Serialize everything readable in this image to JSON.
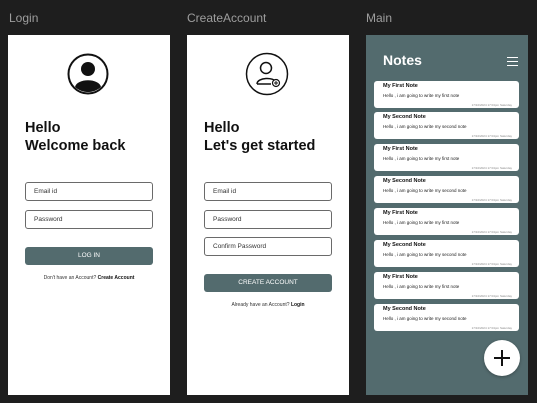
{
  "frames": {
    "login_label": "Login",
    "create_label": "CreateAccount",
    "main_label": "Main"
  },
  "login": {
    "heading_line1": "Hello",
    "heading_line2": "Welcome back",
    "email_placeholder": "Email id",
    "password_placeholder": "Password",
    "login_button": "LOG IN",
    "footer_text": "Don't have an Account? ",
    "footer_link": "Create Account"
  },
  "create": {
    "heading_line1": "Hello",
    "heading_line2": "Let's get started",
    "email_placeholder": "Email id",
    "password_placeholder": "Password",
    "confirm_placeholder": "Confirm Password",
    "create_button": "CREATE ACCOUNT",
    "footer_text": "Already have an Account? ",
    "footer_link": "Login"
  },
  "main": {
    "title": "Notes",
    "notes": [
      {
        "title": "My First Note",
        "body": "Hello , i am going to write my first note",
        "timestamp": "17/10/2024 17:04pm Saturday"
      },
      {
        "title": "My Second Note",
        "body": "Hello , i am going to write my second note",
        "timestamp": "17/10/2024 17:04pm Saturday"
      },
      {
        "title": "My First Note",
        "body": "Hello , i am going to write my first note",
        "timestamp": "17/10/2024 17:04pm Saturday"
      },
      {
        "title": "My Second Note",
        "body": "Hello , i am going to write my second note",
        "timestamp": "17/10/2024 17:04pm Saturday"
      },
      {
        "title": "My First Note",
        "body": "Hello , i am going to write my first note",
        "timestamp": "17/10/2024 17:04pm Saturday"
      },
      {
        "title": "My Second Note",
        "body": "Hello , i am going to write my second note",
        "timestamp": "17/10/2024 17:04pm Saturday"
      },
      {
        "title": "My First Note",
        "body": "Hello , i am going to write my first note",
        "timestamp": "17/10/2024 17:04pm Saturday"
      },
      {
        "title": "My Second Note",
        "body": "Hello , i am going to write my second note",
        "timestamp": "17/10/2024 17:04pm Saturday"
      }
    ]
  },
  "colors": {
    "accent": "#536b6e",
    "canvas": "#1e1e1e"
  },
  "icons": {
    "login_avatar": "user-avatar-icon",
    "create_avatar": "add-user-icon",
    "menu": "hamburger-menu-icon",
    "fab": "plus-icon"
  }
}
